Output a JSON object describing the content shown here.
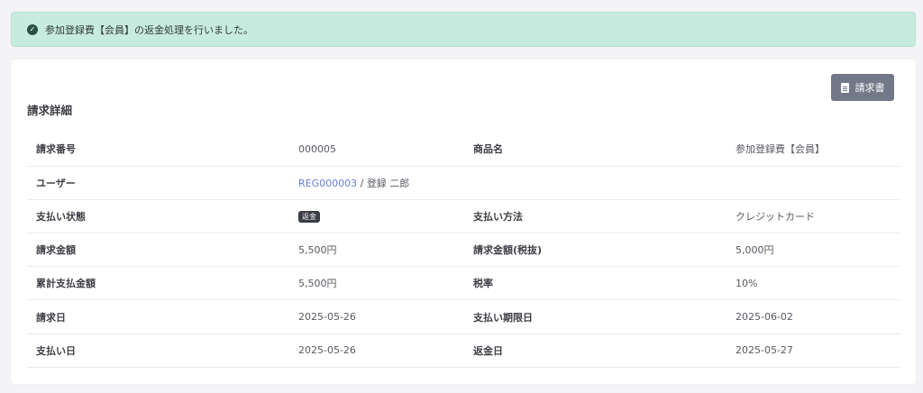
{
  "alert": {
    "message": "参加登録費【会員】の返金処理を行いました。"
  },
  "card": {
    "title": "請求詳細",
    "invoice_button_label": "請求書"
  },
  "details": {
    "invoice_number_label": "請求番号",
    "invoice_number": "000005",
    "product_name_label": "商品名",
    "product_name": "参加登録費【会員】",
    "user_label": "ユーザー",
    "user_code": "REG000003",
    "user_separator": " / ",
    "user_name": "登録 二郎",
    "payment_status_label": "支払い状態",
    "payment_status": "返金",
    "payment_method_label": "支払い方法",
    "payment_method": "クレジットカード",
    "amount_label": "請求金額",
    "amount": "5,500円",
    "amount_ex_tax_label": "請求金額(税抜)",
    "amount_ex_tax": "5,000円",
    "cumulative_paid_label": "累計支払金額",
    "cumulative_paid": "5,500円",
    "tax_rate_label": "税率",
    "tax_rate": "10%",
    "invoice_date_label": "請求日",
    "invoice_date": "2025-05-26",
    "due_date_label": "支払い期限日",
    "due_date": "2025-06-02",
    "paid_date_label": "支払い日",
    "paid_date": "2025-05-26",
    "refund_date_label": "返金日",
    "refund_date": "2025-05-27"
  }
}
